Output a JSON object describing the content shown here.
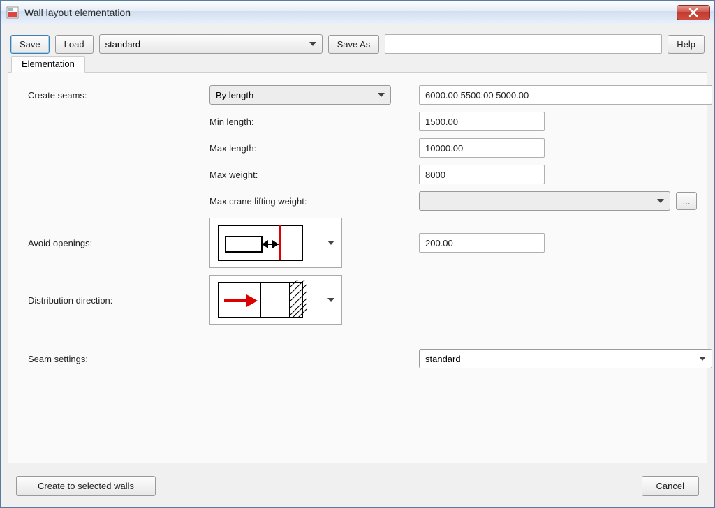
{
  "title": "Wall layout elementation",
  "toolbar": {
    "save": "Save",
    "load": "Load",
    "preset": "standard",
    "saveas": "Save As",
    "saveas_name": "",
    "help": "Help"
  },
  "tab": {
    "label": "Elementation"
  },
  "labels": {
    "create_seams": "Create seams:",
    "min_length": "Min length:",
    "max_length": "Max length:",
    "max_weight": "Max weight:",
    "max_crane": "Max crane lifting weight:",
    "avoid_openings": "Avoid openings:",
    "distribution": "Distribution direction:",
    "seam_settings": "Seam settings:"
  },
  "values": {
    "create_seams_mode": "By length",
    "seam_lengths": "6000.00 5500.00 5000.00",
    "min_length": "1500.00",
    "max_length": "10000.00",
    "max_weight": "8000",
    "max_crane": "",
    "avoid_value": "200.00",
    "seam_settings": "standard",
    "ellipsis": "..."
  },
  "footer": {
    "create": "Create to selected walls",
    "cancel": "Cancel"
  }
}
